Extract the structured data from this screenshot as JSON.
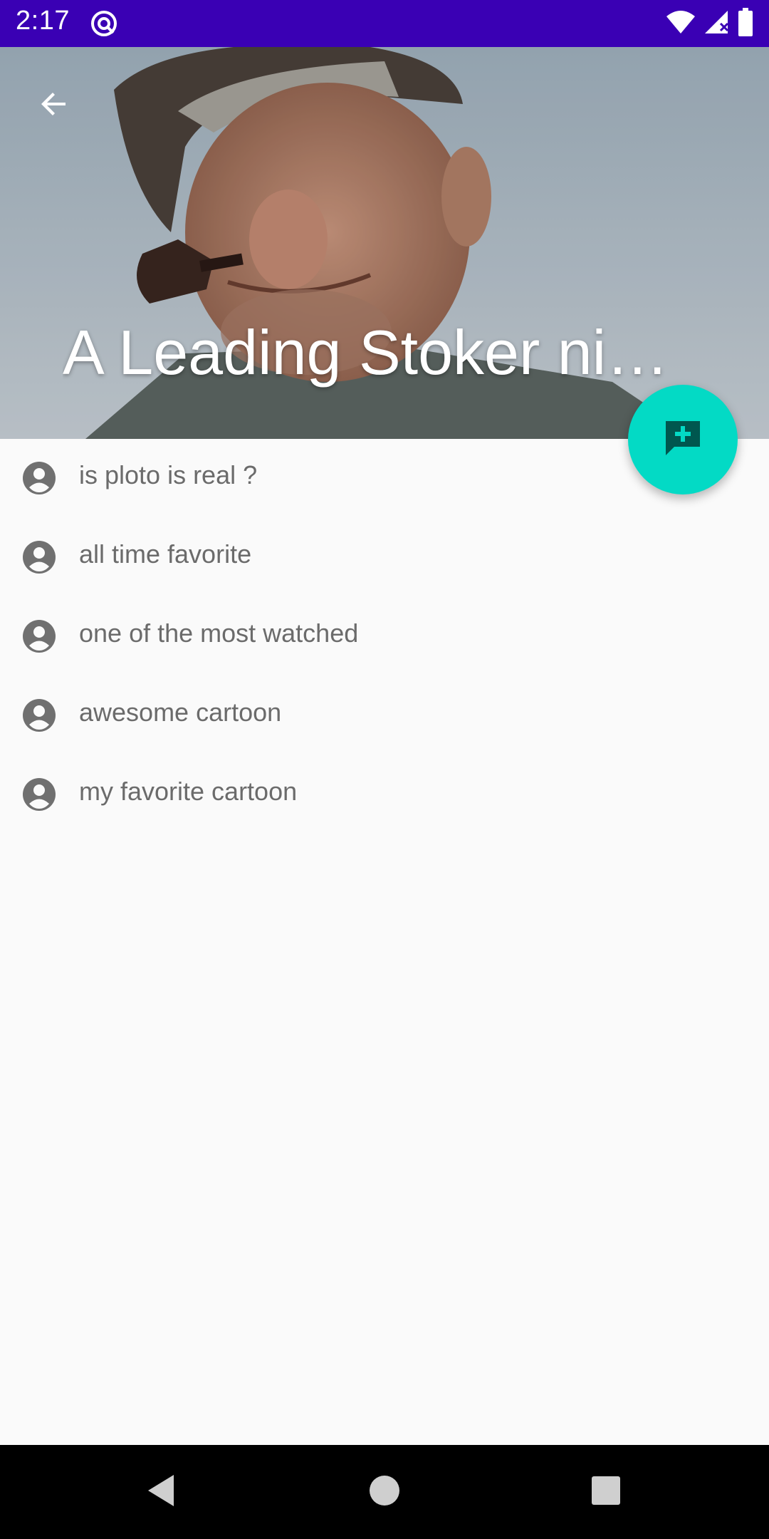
{
  "status_bar": {
    "time": "2:17",
    "background_color": "#3a00b4",
    "icons": [
      "app-notification-icon",
      "wifi-icon",
      "signal-icon",
      "battery-icon"
    ]
  },
  "header": {
    "title": "A Leading Stoker ni…",
    "back_icon": "arrow-back-icon",
    "image_description_icon": "header-photo"
  },
  "fab": {
    "icon": "add-comment-icon",
    "color": "#03dac5"
  },
  "comments": [
    {
      "text": "is ploto is real ?",
      "icon": "account-circle-icon"
    },
    {
      "text": "all time favorite",
      "icon": "account-circle-icon"
    },
    {
      "text": "one of the most watched",
      "icon": "account-circle-icon"
    },
    {
      "text": "awesome cartoon",
      "icon": "account-circle-icon"
    },
    {
      "text": "my favorite cartoon",
      "icon": "account-circle-icon"
    }
  ],
  "nav_bar": {
    "buttons": [
      "back-triangle-icon",
      "home-circle-icon",
      "recents-square-icon"
    ]
  }
}
